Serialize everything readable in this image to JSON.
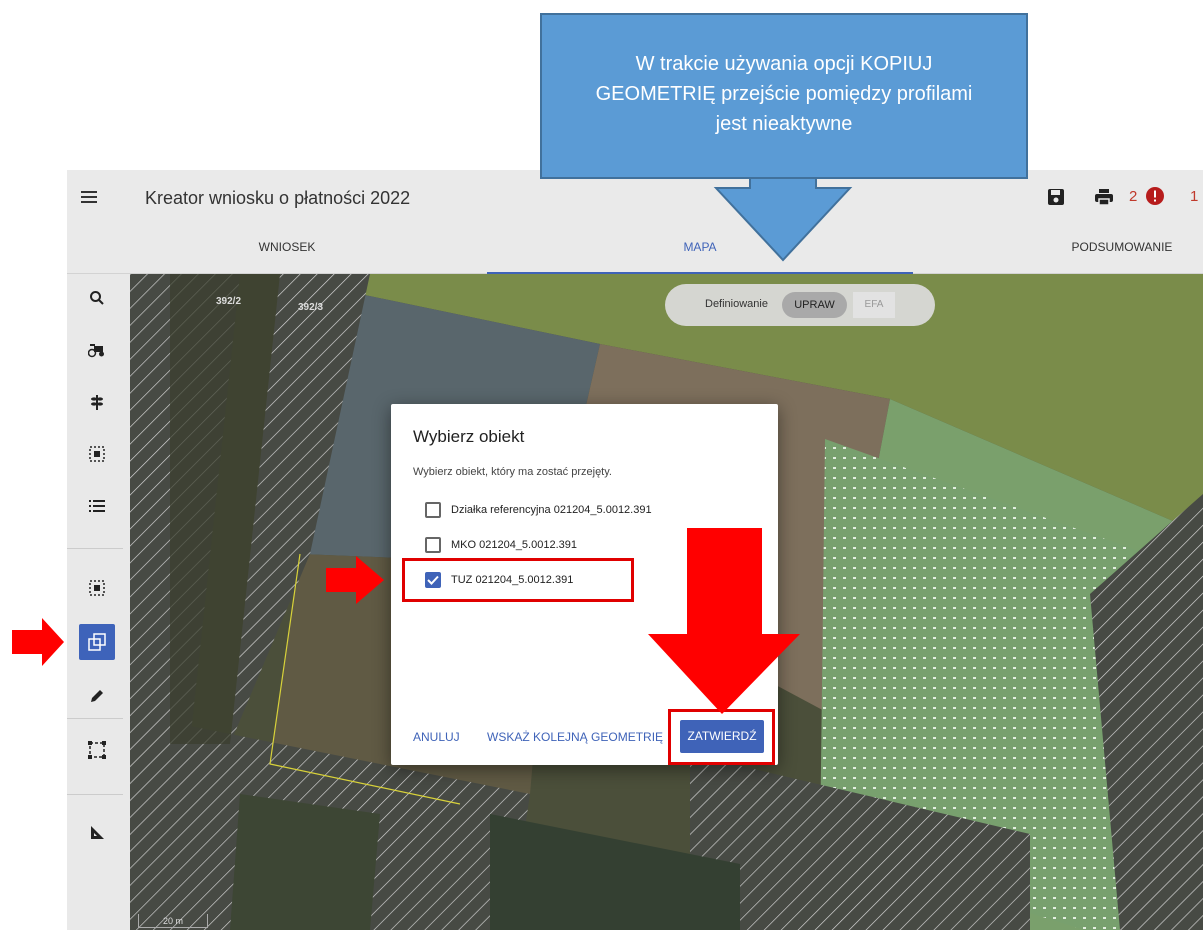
{
  "header": {
    "title": "Kreator wniosku o płatności 2022",
    "menu_icon": "hamburger-menu-icon",
    "save_icon": "save-icon",
    "print_icon": "print-icon",
    "warnings_count": "2",
    "warning_icon": "error-circle-icon",
    "errors_count": "1",
    "colors": {
      "accent": "#3f63b8",
      "alert": "#c0392b"
    }
  },
  "tabs": [
    {
      "label": "WNIOSEK"
    },
    {
      "label": "MAPA",
      "active": true
    },
    {
      "label": "PODSUMOWANIE"
    }
  ],
  "sidebar": {
    "items": [
      {
        "icon": "search-icon"
      },
      {
        "icon": "tractor-icon"
      },
      {
        "icon": "plant-icon"
      },
      {
        "icon": "select-area-icon"
      },
      {
        "icon": "list-icon"
      },
      {
        "icon": "select-area-icon"
      },
      {
        "icon": "copy-geometry-icon",
        "active": true
      },
      {
        "icon": "pencil-icon"
      },
      {
        "icon": "bounding-box-icon"
      },
      {
        "icon": "measure-icon"
      }
    ]
  },
  "map": {
    "profile": {
      "label": "Definiowanie",
      "active_option": "UPRAW",
      "inactive_option": "EFA"
    },
    "parcel_labels": [
      "392/2",
      "392/3"
    ],
    "scale": "20 m"
  },
  "dialog": {
    "title": "Wybierz obiekt",
    "subtitle": "Wybierz obiekt, który ma zostać przejęty.",
    "options": [
      {
        "label": "Działka referencyjna 021204_5.0012.391",
        "checked": false
      },
      {
        "label": "MKO 021204_5.0012.391",
        "checked": false
      },
      {
        "label": "TUZ 021204_5.0012.391",
        "checked": true
      }
    ],
    "buttons": {
      "cancel": "ANULUJ",
      "next_geometry": "WSKAŻ KOLEJNĄ GEOMETRIĘ",
      "confirm": "ZATWIERDŹ"
    }
  },
  "annotation": {
    "callout_text": "W trakcie używania opcji KOPIUJ GEOMETRIĘ przejście pomiędzy profilami jest nieaktywne",
    "callout_color": "#5b9bd5",
    "arrow_color": "#ff0000"
  }
}
